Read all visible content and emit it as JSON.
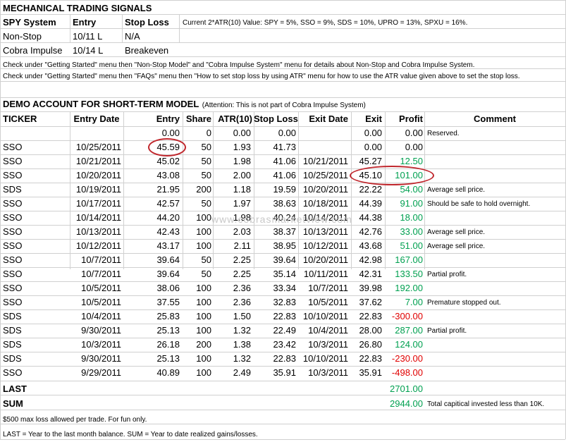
{
  "title": "MECHANICAL TRADING SIGNALS",
  "signals": {
    "headers": [
      "SPY System",
      "Entry",
      "Stop Loss"
    ],
    "atr_note": "Current 2*ATR(10) Value: SPY = 5%, SSO = 9%, SDS = 10%, UPRO = 13%, SPXU = 16%.",
    "rows": [
      [
        "Non-Stop",
        "10/11 L",
        "N/A"
      ],
      [
        "Cobra Impulse",
        "10/14 L",
        "Breakeven"
      ]
    ]
  },
  "notes": [
    "Check under \"Getting Started\" menu then \"Non-Stop Model\" and \"Cobra Impulse System\" menu  for details about Non-Stop and Cobra Impulse System.",
    "Check under \"Getting Started\" menu then \"FAQs\" menu then \"How to set stop loss by using ATR\" menu for how to use the ATR value given above to set the stop loss."
  ],
  "demo": {
    "title": "DEMO ACCOUNT FOR SHORT-TERM MODEL",
    "attention": "(Attention: This is not part of Cobra Impulse System)",
    "headers": [
      "TICKER",
      "Entry Date",
      "Entry",
      "Share",
      "ATR(10)",
      "Stop Loss",
      "Exit Date",
      "Exit",
      "Profit",
      "Comment"
    ],
    "rows": [
      [
        "",
        "",
        "0.00",
        "0",
        "0.00",
        "0.00",
        "",
        "0.00",
        "0.00",
        "Reserved."
      ],
      [
        "SSO",
        "10/25/2011",
        "45.59",
        "50",
        "1.93",
        "41.73",
        "",
        "0.00",
        "0.00",
        ""
      ],
      [
        "SSO",
        "10/21/2011",
        "45.02",
        "50",
        "1.98",
        "41.06",
        "10/21/2011",
        "45.27",
        "12.50",
        ""
      ],
      [
        "SSO",
        "10/20/2011",
        "43.08",
        "50",
        "2.00",
        "41.06",
        "10/25/2011",
        "45.10",
        "101.00",
        ""
      ],
      [
        "SDS",
        "10/19/2011",
        "21.95",
        "200",
        "1.18",
        "19.59",
        "10/20/2011",
        "22.22",
        "54.00",
        "Average sell price."
      ],
      [
        "SSO",
        "10/17/2011",
        "42.57",
        "50",
        "1.97",
        "38.63",
        "10/18/2011",
        "44.39",
        "91.00",
        "Should be safe to hold overnight."
      ],
      [
        "SSO",
        "10/14/2011",
        "44.20",
        "100",
        "1.98",
        "40.24",
        "10/14/2011",
        "44.38",
        "18.00",
        ""
      ],
      [
        "SSO",
        "10/13/2011",
        "42.43",
        "100",
        "2.03",
        "38.37",
        "10/13/2011",
        "42.76",
        "33.00",
        "Average sell price."
      ],
      [
        "SSO",
        "10/12/2011",
        "43.17",
        "100",
        "2.11",
        "38.95",
        "10/12/2011",
        "43.68",
        "51.00",
        "Average sell price."
      ],
      [
        "SSO",
        "10/7/2011",
        "39.64",
        "50",
        "2.25",
        "39.64",
        "10/20/2011",
        "42.98",
        "167.00",
        ""
      ],
      [
        "SSO",
        "10/7/2011",
        "39.64",
        "50",
        "2.25",
        "35.14",
        "10/11/2011",
        "42.31",
        "133.50",
        "Partial profit."
      ],
      [
        "SSO",
        "10/5/2011",
        "38.06",
        "100",
        "2.36",
        "33.34",
        "10/7/2011",
        "39.98",
        "192.00",
        ""
      ],
      [
        "SSO",
        "10/5/2011",
        "37.55",
        "100",
        "2.36",
        "32.83",
        "10/5/2011",
        "37.62",
        "7.00",
        "Premature stopped out."
      ],
      [
        "SDS",
        "10/4/2011",
        "25.83",
        "100",
        "1.50",
        "22.83",
        "10/10/2011",
        "22.83",
        "-300.00",
        ""
      ],
      [
        "SDS",
        "9/30/2011",
        "25.13",
        "100",
        "1.32",
        "22.49",
        "10/4/2011",
        "28.00",
        "287.00",
        "Partial profit."
      ],
      [
        "SDS",
        "10/3/2011",
        "26.18",
        "200",
        "1.38",
        "23.42",
        "10/3/2011",
        "26.80",
        "124.00",
        ""
      ],
      [
        "SDS",
        "9/30/2011",
        "25.13",
        "100",
        "1.32",
        "22.83",
        "10/10/2011",
        "22.83",
        "-230.00",
        ""
      ],
      [
        "SSO",
        "9/29/2011",
        "40.89",
        "100",
        "2.49",
        "35.91",
        "10/3/2011",
        "35.91",
        "-498.00",
        ""
      ]
    ],
    "last": {
      "label": "LAST",
      "value": "2701.00"
    },
    "sum": {
      "label": "SUM",
      "value": "2944.00",
      "comment": "Total capitical invested less than 10K."
    }
  },
  "footer": [
    "$500 max loss allowed per trade. For fun only.",
    "LAST = Year to the last month balance. SUM = Year to date realized gains/losses."
  ],
  "watermark": "www.cobrasmarketview.com",
  "colors": {
    "gain": "#00a050",
    "loss": "#e00000",
    "highlight": "#c0272d",
    "grid": "#d0d0d0"
  }
}
